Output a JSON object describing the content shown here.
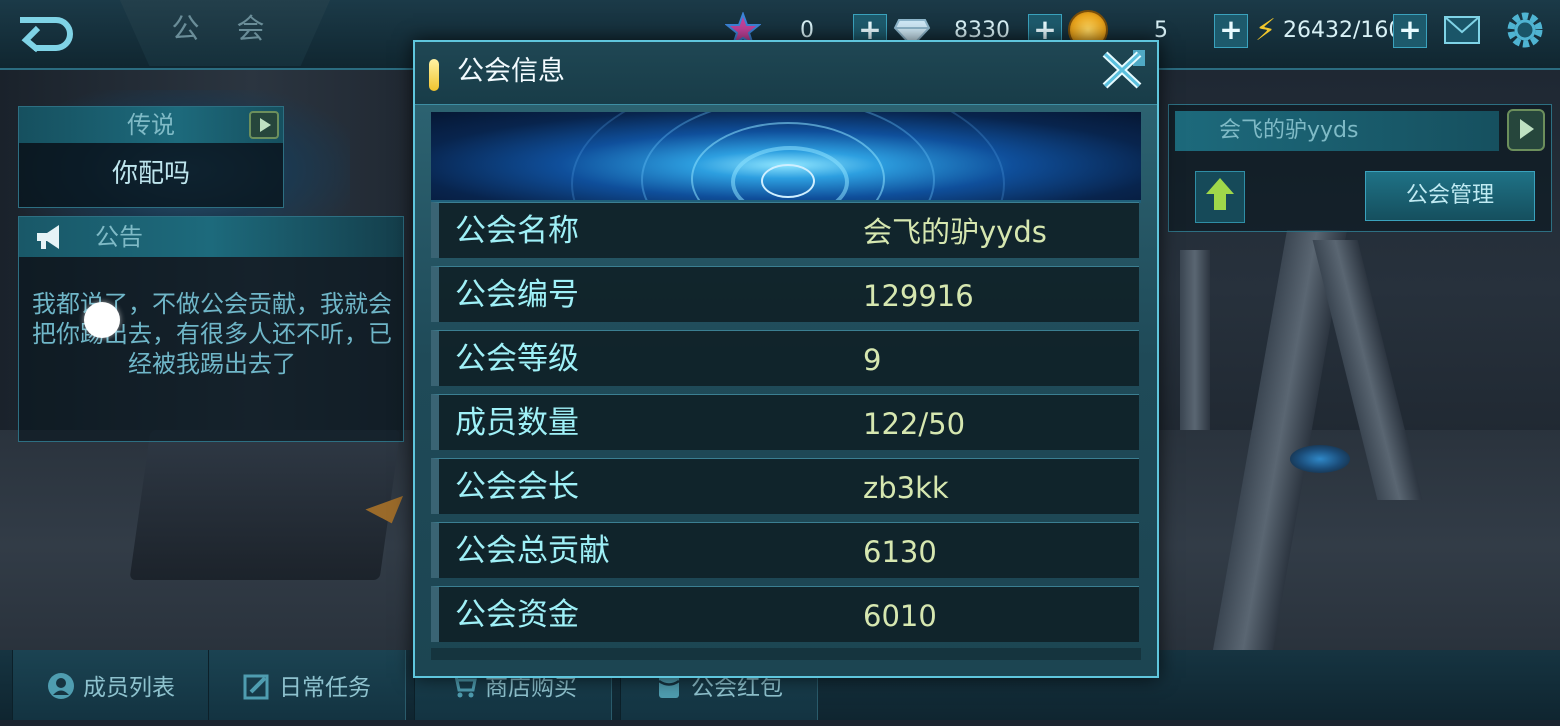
{
  "top_bar": {
    "title": "公 会",
    "resources": {
      "star_value": "0",
      "gem_value": "8330",
      "coin_value": "5",
      "energy_value": "26432/160"
    },
    "plus_label": "+"
  },
  "left": {
    "rank_title": "传说",
    "rank_name": "你配吗",
    "notice_title": "公告",
    "notice_text": "我都说了，不做公会贡献，我就会把你踢出去，有很多人还不听，已经被我踢出去了"
  },
  "right": {
    "guild_name": "会飞的驴yyds",
    "manage_button": "公会管理"
  },
  "modal": {
    "title": "公会信息",
    "rows": [
      {
        "label": "公会名称",
        "value": "会飞的驴yyds"
      },
      {
        "label": "公会编号",
        "value": "129916"
      },
      {
        "label": "公会等级",
        "value": "9"
      },
      {
        "label": "成员数量",
        "value": "122/50"
      },
      {
        "label": "公会会长",
        "value": "zb3kk"
      },
      {
        "label": "公会总贡献",
        "value": "6130"
      },
      {
        "label": "公会资金",
        "value": "6010"
      }
    ]
  },
  "bottom_tabs": [
    {
      "label": "成员列表",
      "icon": "member-icon"
    },
    {
      "label": "日常任务",
      "icon": "task-icon"
    },
    {
      "label": "商店购买",
      "icon": "cart-icon"
    },
    {
      "label": "公会红包",
      "icon": "red-packet-icon"
    }
  ],
  "colors": {
    "accent": "#5fc6dd",
    "label_text": "#9ff0f7",
    "value_text": "#d6e7b0",
    "energy": "#f1c72c"
  }
}
